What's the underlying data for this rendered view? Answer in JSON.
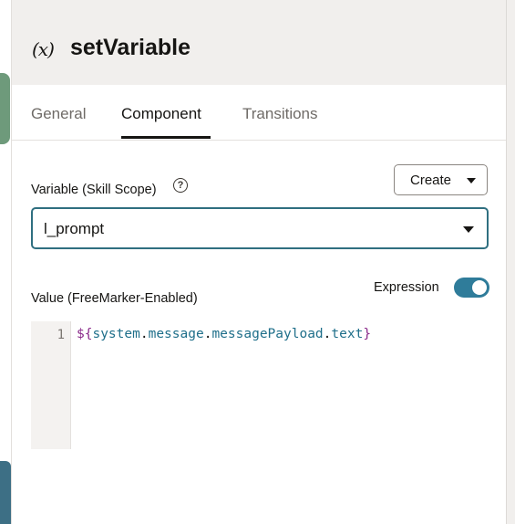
{
  "header": {
    "icon": "variable-icon",
    "title": "setVariable"
  },
  "tabs": [
    {
      "label": "General",
      "active": false
    },
    {
      "label": "Component",
      "active": true
    },
    {
      "label": "Transitions",
      "active": false
    }
  ],
  "variable": {
    "label": "Variable (Skill Scope)",
    "help_icon": "help-circle-icon",
    "create_label": "Create",
    "selected": "l_prompt"
  },
  "value": {
    "label": "Value (FreeMarker-Enabled)",
    "expression_label": "Expression",
    "expression_enabled": true
  },
  "editor": {
    "line_number": "1",
    "tokens": [
      "${",
      "system",
      ".",
      "message",
      ".",
      "messagePayload",
      ".",
      "text",
      "}"
    ]
  },
  "colors": {
    "accent": "#2f7c9a",
    "header_bg": "#f1efed"
  }
}
